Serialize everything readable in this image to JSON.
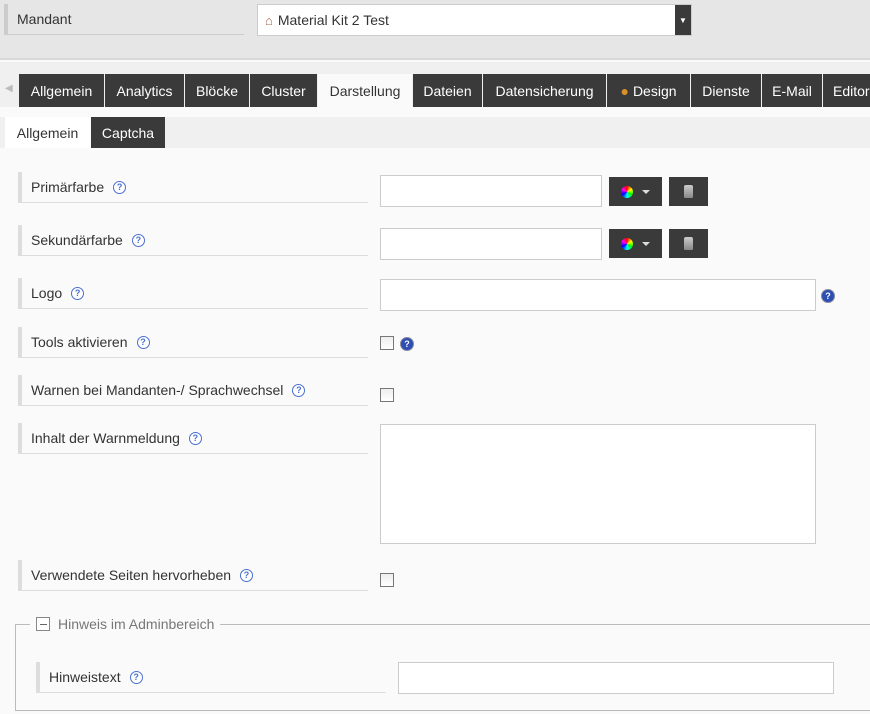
{
  "mandant": {
    "label": "Mandant",
    "value": "Material Kit 2 Test",
    "icon": "house-icon"
  },
  "tabs": [
    {
      "label": "Allgemein"
    },
    {
      "label": "Analytics"
    },
    {
      "label": "Blöcke"
    },
    {
      "label": "Cluster"
    },
    {
      "label": "Darstellung",
      "active": true
    },
    {
      "label": "Dateien"
    },
    {
      "label": "Datensicherung"
    },
    {
      "label": "Design",
      "icon": "palette-icon"
    },
    {
      "label": "Dienste"
    },
    {
      "label": "E-Mail"
    },
    {
      "label": "Editor"
    }
  ],
  "subtabs": [
    {
      "label": "Allgemein",
      "active": true
    },
    {
      "label": "Captcha"
    }
  ],
  "fields": {
    "primary": {
      "label": "Primärfarbe",
      "value": ""
    },
    "secondary": {
      "label": "Sekundärfarbe",
      "value": ""
    },
    "logo": {
      "label": "Logo",
      "value": ""
    },
    "tools": {
      "label": "Tools aktivieren",
      "checked": false
    },
    "warn": {
      "label": "Warnen bei Mandanten-/ Sprachwechsel",
      "checked": false
    },
    "warn_text": {
      "label": "Inhalt der Warnmeldung",
      "value": ""
    },
    "highlight": {
      "label": "Verwendete Seiten hervorheben",
      "checked": false
    }
  },
  "admin_section": {
    "legend": "Hinweis im Adminbereich",
    "hint": {
      "label": "Hinweistext",
      "value": ""
    }
  },
  "help_glyph": "?"
}
